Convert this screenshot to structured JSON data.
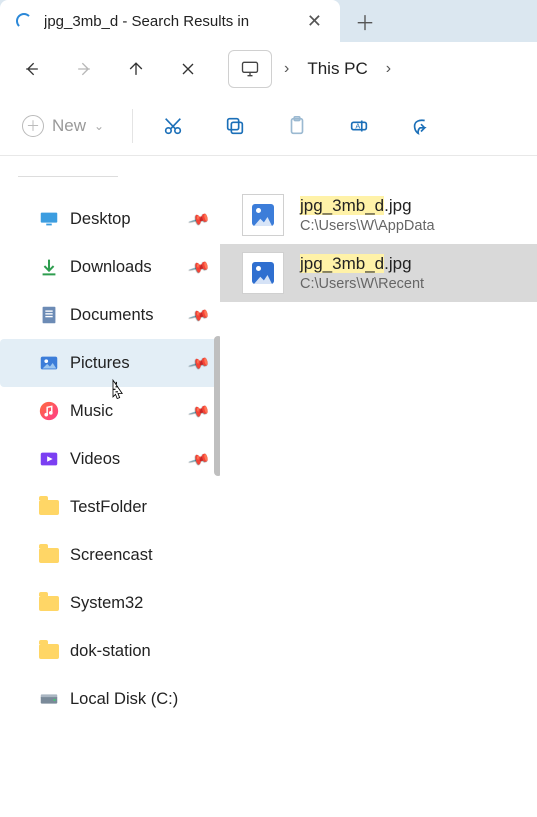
{
  "tabs": {
    "active": {
      "title": "jpg_3mb_d - Search Results in"
    }
  },
  "address": {
    "location": "This PC"
  },
  "toolbar": {
    "new_label": "New"
  },
  "sidebar": {
    "items": [
      {
        "label": "Desktop",
        "icon": "desktop",
        "pinned": true,
        "selected": false
      },
      {
        "label": "Downloads",
        "icon": "download",
        "pinned": true,
        "selected": false
      },
      {
        "label": "Documents",
        "icon": "document",
        "pinned": true,
        "selected": false
      },
      {
        "label": "Pictures",
        "icon": "pictures",
        "pinned": true,
        "selected": true
      },
      {
        "label": "Music",
        "icon": "music",
        "pinned": true,
        "selected": false
      },
      {
        "label": "Videos",
        "icon": "videos",
        "pinned": true,
        "selected": false
      },
      {
        "label": "TestFolder",
        "icon": "folder",
        "pinned": false,
        "selected": false
      },
      {
        "label": "Screencast",
        "icon": "folder",
        "pinned": false,
        "selected": false
      },
      {
        "label": "System32",
        "icon": "folder",
        "pinned": false,
        "selected": false
      },
      {
        "label": "dok-station",
        "icon": "folder",
        "pinned": false,
        "selected": false
      },
      {
        "label": "Local Disk (C:)",
        "icon": "disk",
        "pinned": false,
        "selected": false
      }
    ]
  },
  "results": [
    {
      "name": "jpg_3mb_d",
      "ext": ".jpg",
      "path": "C:\\Users\\W\\AppData",
      "selected": false
    },
    {
      "name": "jpg_3mb_d",
      "ext": ".jpg",
      "path": "C:\\Users\\W\\Recent",
      "selected": true
    }
  ]
}
